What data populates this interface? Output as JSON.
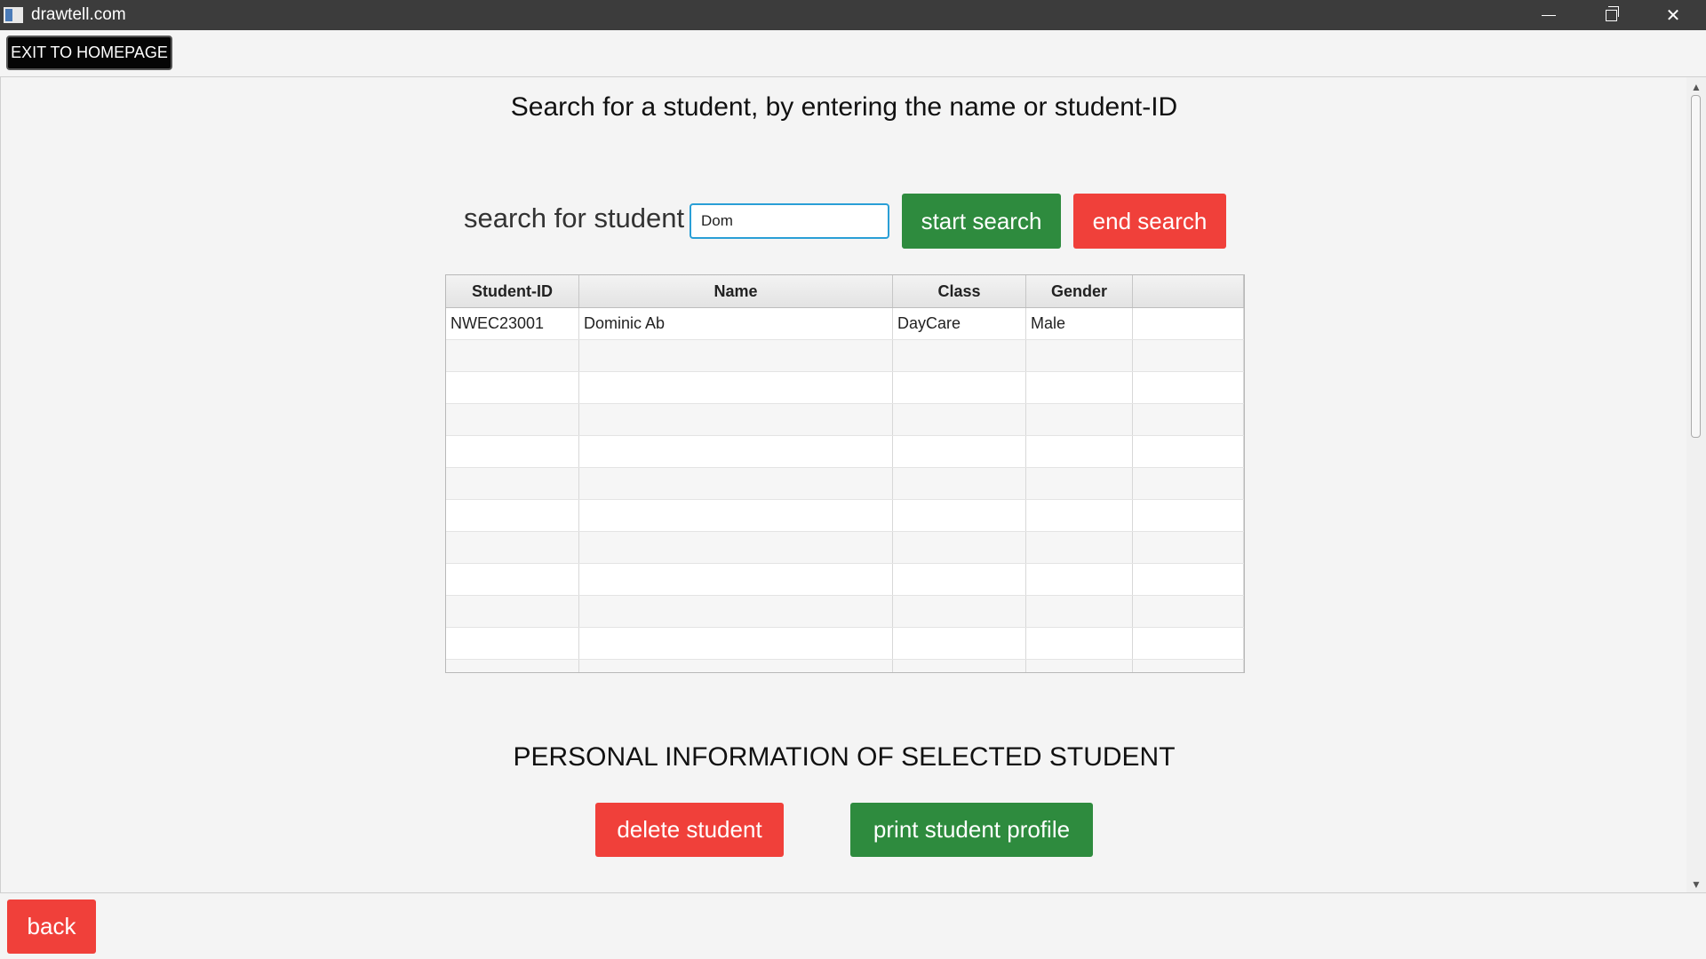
{
  "window": {
    "title": "drawtell.com",
    "controls": {
      "minimize": "",
      "maximize": "",
      "close": "✕"
    }
  },
  "topbar": {
    "exit_label": "EXIT TO HOMEPAGE"
  },
  "page": {
    "heading": "Search for a student, by entering the name or student-ID"
  },
  "search": {
    "label": "search for student",
    "value": "Dom",
    "start_label": "start search",
    "end_label": "end search"
  },
  "table": {
    "columns": [
      "Student-ID",
      "Name",
      "Class",
      "Gender",
      ""
    ],
    "rows": [
      [
        "NWEC23001",
        "Dominic Ab",
        "DayCare",
        "Male",
        ""
      ],
      [
        "",
        "",
        "",
        "",
        ""
      ],
      [
        "",
        "",
        "",
        "",
        ""
      ],
      [
        "",
        "",
        "",
        "",
        ""
      ],
      [
        "",
        "",
        "",
        "",
        ""
      ],
      [
        "",
        "",
        "",
        "",
        ""
      ],
      [
        "",
        "",
        "",
        "",
        ""
      ],
      [
        "",
        "",
        "",
        "",
        ""
      ],
      [
        "",
        "",
        "",
        "",
        ""
      ],
      [
        "",
        "",
        "",
        "",
        ""
      ],
      [
        "",
        "",
        "",
        "",
        ""
      ],
      [
        "",
        "",
        "",
        "",
        ""
      ]
    ]
  },
  "profile": {
    "title": "PERSONAL INFORMATION OF SELECTED STUDENT",
    "delete_label": "delete student",
    "print_label": "print student profile"
  },
  "footer": {
    "back_label": "back"
  },
  "colors": {
    "green": "#2e8b3e",
    "red": "#f0403a",
    "focus": "#2a9fd6"
  },
  "icons": {
    "app": "app-window-icon",
    "scroll_up": "chevron-up-icon",
    "scroll_down": "chevron-down-icon"
  }
}
